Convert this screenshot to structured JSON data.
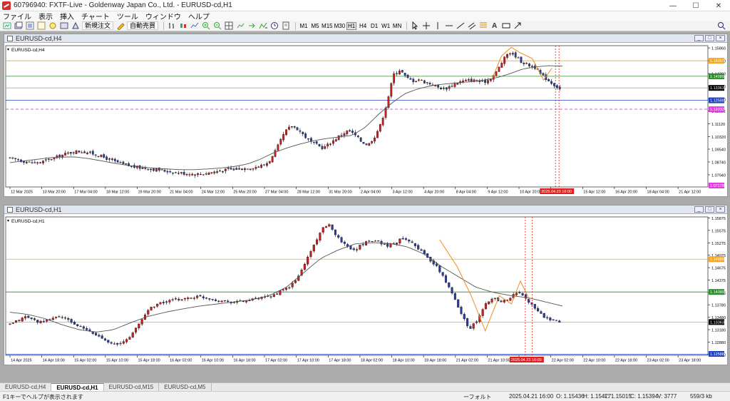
{
  "window": {
    "title": "60796940: FXTF-Live - Goldenway Japan Co., Ltd. - EURUSD-cd,H1"
  },
  "menu": [
    "ファイル",
    "表示",
    "挿入",
    "チャート",
    "ツール",
    "ウィンドウ",
    "ヘルプ"
  ],
  "toolbar": {
    "new_order": "新規注文",
    "auto_trade": "自動売買",
    "timeframes": [
      "M1",
      "M5",
      "M15",
      "M30",
      "H1",
      "H4",
      "D1",
      "W1",
      "MN"
    ],
    "active_timeframe": "H1"
  },
  "charts": [
    {
      "window_title": "EURUSD-cd,H4",
      "label": "EURUSD-cd,H4",
      "x_ticks": [
        "12 Mar 2025",
        "13 Mar 20:00",
        "17 Mar 04:00",
        "18 Mar 12:00",
        "19 Mar 20:00",
        "21 Mar 04:00",
        "24 Mar 12:00",
        "25 Mar 20:00",
        "27 Mar 04:00",
        "28 Mar 12:00",
        "31 Mar 20:00",
        "2 Apr 04:00",
        "3 Apr 12:00",
        "4 Apr 20:00",
        "8 Apr 04:00",
        "9 Apr 12:00",
        "10 Apr 20:00",
        "14 Apr 04:00",
        "15 Apr 12:00",
        "16 Apr 20:00",
        "18 Apr 04:00",
        "21 Apr 12:00"
      ],
      "y_ticks": [
        "1.15860",
        "1.15060",
        "1.14260",
        "1.13460",
        "1.12660",
        "1.11920",
        "1.11120",
        "1.10320",
        "1.09540",
        "1.08740",
        "1.07940"
      ],
      "price_tags": [
        {
          "text": "1.15057",
          "color": "#f5a623"
        },
        {
          "text": "1.14089",
          "color": "#2e8b2e"
        },
        {
          "text": "1.13363",
          "color": "#000000"
        },
        {
          "text": "1.12588",
          "color": "#2040c0"
        },
        {
          "text": "1.12032",
          "color": "#e040e0"
        },
        {
          "text": "1.07178",
          "color": "#e040e0"
        }
      ],
      "cursor_tag": "2025.04.23 16:00"
    },
    {
      "window_title": "EURUSD-cd,H1",
      "label": "EURUSD-cd,H1",
      "x_ticks": [
        "14 Apr 2025",
        "14 Apr 18:00",
        "15 Apr 02:00",
        "15 Apr 10:00",
        "15 Apr 18:00",
        "16 Apr 02:00",
        "16 Apr 10:00",
        "16 Apr 18:00",
        "17 Apr 02:00",
        "17 Apr 10:00",
        "17 Apr 18:00",
        "18 Apr 02:00",
        "18 Apr 10:00",
        "18 Apr 18:00",
        "21 Apr 02:00",
        "21 Apr 10:00",
        "21 Apr 18:00",
        "22 Apr 02:00",
        "22 Apr 10:00",
        "22 Apr 18:00",
        "23 Apr 02:00",
        "23 Apr 18:00"
      ],
      "y_ticks": [
        "1.15875",
        "1.15575",
        "1.15275",
        "1.14975",
        "1.14675",
        "1.14375",
        "1.14075",
        "1.13780",
        "1.13480",
        "1.13180",
        "1.12880",
        "1.12580"
      ],
      "price_tags": [
        {
          "text": "1.14880",
          "color": "#f5a623"
        },
        {
          "text": "1.14089",
          "color": "#2e8b2e"
        },
        {
          "text": "1.13363",
          "color": "#000000"
        },
        {
          "text": "1.12588",
          "color": "#2040c0"
        }
      ],
      "cursor_tag": "2025.04.23 16:00"
    }
  ],
  "tabs": [
    "EURUSD-cd,H4",
    "EURUSD-cd,H1",
    "EURUSD-cd,M15",
    "EURUSD-cd,M5"
  ],
  "active_tab": 1,
  "status": {
    "help": "F1キーでヘルプが表示されます",
    "profile": "ーフォルト",
    "time": "2025.04.21 16:00",
    "open": "O: 1.15436",
    "high": "H: 1.15477",
    "low": "L: 1.15015",
    "close": "C: 1.15394",
    "volume": "V: 3777",
    "traffic": "559/3 kb"
  },
  "chart_data": [
    {
      "type": "candlestick",
      "symbol": "EURUSD-cd",
      "timeframe": "H4",
      "ylim": [
        1.0718,
        1.16
      ],
      "close_path": [
        1.0895,
        1.089,
        1.088,
        1.0872,
        1.0868,
        1.0875,
        1.0888,
        1.09,
        1.0915,
        1.0928,
        1.0938,
        1.094,
        1.0935,
        1.0925,
        1.0912,
        1.0898,
        1.0882,
        1.0868,
        1.0855,
        1.0846,
        1.084,
        1.0836,
        1.0832,
        1.0826,
        1.082,
        1.0814,
        1.0808,
        1.0804,
        1.08,
        1.0798,
        1.08,
        1.0806,
        1.0812,
        1.082,
        1.0826,
        1.083,
        1.0832,
        1.0835,
        1.084,
        1.0846,
        1.086,
        1.09,
        1.098,
        1.106,
        1.11,
        1.108,
        1.104,
        1.1,
        1.098,
        1.096,
        1.099,
        1.102,
        1.105,
        1.107,
        1.104,
        1.1,
        1.098,
        1.103,
        1.111,
        1.125,
        1.142,
        1.145,
        1.14,
        1.138,
        1.139,
        1.137,
        1.136,
        1.134,
        1.133,
        1.135,
        1.137,
        1.138,
        1.1385,
        1.138,
        1.137,
        1.139,
        1.143,
        1.15,
        1.156,
        1.154,
        1.15,
        1.148,
        1.147,
        1.142,
        1.139,
        1.136,
        1.133
      ],
      "ma_path": [
        1.087,
        1.088,
        1.089,
        1.09,
        1.0905,
        1.0905,
        1.0895,
        1.088,
        1.0865,
        1.0852,
        1.0842,
        1.0835,
        1.083,
        1.0826,
        1.0826,
        1.083,
        1.0836,
        1.0845,
        1.086,
        1.089,
        1.093,
        1.096,
        1.0985,
        1.1005,
        1.102,
        1.103,
        1.104,
        1.109,
        1.117,
        1.124,
        1.13,
        1.133,
        1.135,
        1.136,
        1.1368,
        1.1375,
        1.1385,
        1.14,
        1.1425,
        1.1455,
        1.1468,
        1.1475,
        1.1472
      ],
      "hlines": [
        1.15057,
        1.14089,
        1.13363,
        1.12588,
        1.12032
      ]
    },
    {
      "type": "candlestick",
      "symbol": "EURUSD-cd",
      "timeframe": "H1",
      "ylim": [
        1.1256,
        1.159
      ],
      "close_path": [
        1.133,
        1.134,
        1.135,
        1.134,
        1.1335,
        1.1345,
        1.135,
        1.1342,
        1.133,
        1.132,
        1.131,
        1.13,
        1.129,
        1.128,
        1.129,
        1.131,
        1.134,
        1.137,
        1.138,
        1.1385,
        1.139,
        1.1392,
        1.1395,
        1.1398,
        1.1395,
        1.139,
        1.1387,
        1.1385,
        1.1386,
        1.1388,
        1.1392,
        1.1395,
        1.14,
        1.141,
        1.142,
        1.144,
        1.148,
        1.152,
        1.156,
        1.157,
        1.154,
        1.152,
        1.151,
        1.1525,
        1.1535,
        1.153,
        1.152,
        1.1528,
        1.154,
        1.153,
        1.151,
        1.149,
        1.147,
        1.144,
        1.14,
        1.136,
        1.132,
        1.134,
        1.138,
        1.1395,
        1.1385,
        1.1395,
        1.141,
        1.139,
        1.137,
        1.135,
        1.134,
        1.1336
      ],
      "ma_path": [
        1.136,
        1.1355,
        1.1345,
        1.133,
        1.1318,
        1.1312,
        1.1318,
        1.1335,
        1.135,
        1.136,
        1.1368,
        1.1375,
        1.138,
        1.1385,
        1.139,
        1.14,
        1.142,
        1.1455,
        1.149,
        1.151,
        1.1525,
        1.1528,
        1.1526,
        1.1518,
        1.15,
        1.147,
        1.1445,
        1.142,
        1.1408,
        1.14,
        1.1395,
        1.1385,
        1.1375
      ],
      "hlines": [
        1.1488,
        1.14089,
        1.13363,
        1.12588
      ]
    }
  ]
}
